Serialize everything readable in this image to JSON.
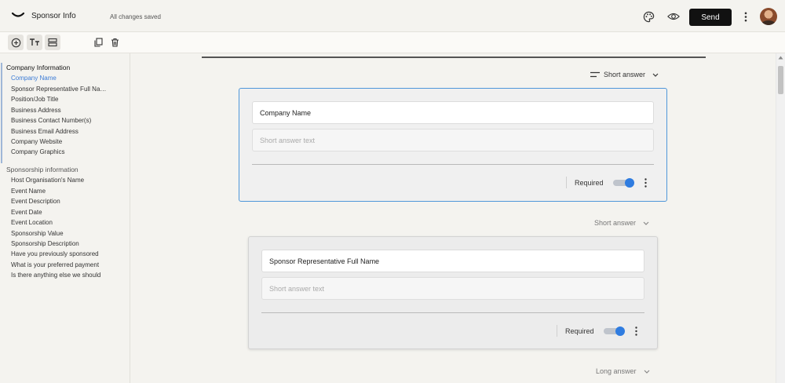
{
  "header": {
    "title": "Sponsor Info",
    "save_status": "All changes saved",
    "send_label": "Send",
    "icons": [
      "logo-icon",
      "palette-icon",
      "eye-icon",
      "more-vert-icon",
      "avatar"
    ]
  },
  "toolbar": {
    "icons": [
      "add-circle-icon",
      "text-format-icon",
      "section-icon",
      "duplicate-icon",
      "trash-icon"
    ]
  },
  "sidebar": {
    "sections": [
      {
        "title": "Company Information",
        "items": [
          "Company Name",
          "Sponsor Representative Full Name",
          "Position/Job Title",
          "Business Address",
          "Business Contact Number(s)",
          "Business Email Address",
          "Company Website",
          "Company Graphics"
        ]
      },
      {
        "title": "Sponsorship information",
        "items": [
          "Host Organisation's Name",
          "Event Name",
          "Event Description",
          "Event Date",
          "Event Location",
          "Sponsorship Value",
          "Sponsorship Description",
          "Have you previously sponsored",
          "What is your preferred payment",
          "Is there anything else we should"
        ]
      }
    ],
    "selected_item": "Company Name"
  },
  "questions": [
    {
      "type": "Short answer",
      "title": "Company Name",
      "placeholder": "Short answer text",
      "required_label": "Required",
      "required": true
    },
    {
      "type": "Short answer",
      "title": "Sponsor Representative Full Name",
      "placeholder": "Short answer text",
      "required_label": "Required",
      "required": true
    },
    {
      "type": "Long answer"
    }
  ],
  "colors": {
    "accent": "#2f7ce0",
    "selected_link": "#3b7bd6",
    "active_card_border": "#4f97d9",
    "send_button": "#111111"
  }
}
